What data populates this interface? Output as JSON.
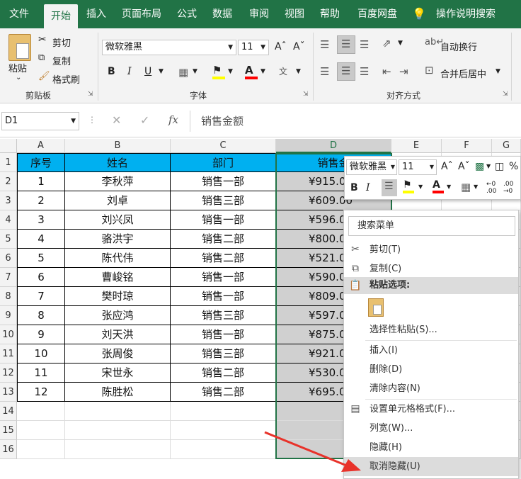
{
  "tabs": [
    "文件",
    "开始",
    "插入",
    "页面布局",
    "公式",
    "数据",
    "审阅",
    "视图",
    "帮助",
    "百度网盘",
    "操作说明搜索"
  ],
  "ribbon": {
    "paste": "粘贴",
    "cut": "剪切",
    "copy": "复制",
    "format_painter": "格式刷",
    "clipboard_group": "剪贴板",
    "font_name": "微软雅黑",
    "font_size": "11",
    "font_group": "字体",
    "bold": "B",
    "italic": "I",
    "underline": "U",
    "wrap_text": "自动换行",
    "merge_center": "合并后居中",
    "align_group": "对齐方式"
  },
  "formula_bar": {
    "name_box": "D1",
    "fx": "fx",
    "value": "销售金额"
  },
  "columns": [
    "A",
    "B",
    "C",
    "D",
    "E",
    "F",
    "G"
  ],
  "rows": [
    "1",
    "2",
    "3",
    "4",
    "5",
    "6",
    "7",
    "8",
    "9",
    "10",
    "11",
    "12",
    "13",
    "14",
    "15",
    "16"
  ],
  "table": {
    "headers": [
      "序号",
      "姓名",
      "部门",
      "销售金"
    ],
    "data": [
      [
        "1",
        "李秋萍",
        "销售一部",
        "¥915.0"
      ],
      [
        "2",
        "刘卓",
        "销售三部",
        "¥609.00"
      ],
      [
        "3",
        "刘兴凤",
        "销售一部",
        "¥596.0"
      ],
      [
        "4",
        "骆洪宇",
        "销售二部",
        "¥800.0"
      ],
      [
        "5",
        "陈代伟",
        "销售二部",
        "¥521.0"
      ],
      [
        "6",
        "曹峻铭",
        "销售一部",
        "¥590.0"
      ],
      [
        "7",
        "樊时琼",
        "销售一部",
        "¥809.0"
      ],
      [
        "8",
        "张应鸿",
        "销售三部",
        "¥597.0"
      ],
      [
        "9",
        "刘天洪",
        "销售一部",
        "¥875.0"
      ],
      [
        "10",
        "张周俊",
        "销售三部",
        "¥921.0"
      ],
      [
        "11",
        "宋世永",
        "销售二部",
        "¥530.0"
      ],
      [
        "12",
        "陈胜松",
        "销售二部",
        "¥695.0"
      ]
    ]
  },
  "mini_toolbar": {
    "font_name": "微软雅黑",
    "font_size": "11",
    "percent": "%",
    "bold": "B",
    "italic": "I"
  },
  "context_menu": {
    "search": "搜索菜单",
    "cut": "剪切(T)",
    "copy": "复制(C)",
    "paste_options": "粘贴选项:",
    "paste_special": "选择性粘贴(S)...",
    "insert": "插入(I)",
    "delete": "删除(D)",
    "clear": "清除内容(N)",
    "format_cells": "设置单元格格式(F)...",
    "col_width": "列宽(W)...",
    "hide": "隐藏(H)",
    "unhide": "取消隐藏(U)"
  },
  "colors": {
    "accent": "#217346",
    "header_fill": "#00b0f0",
    "annotation": "#e8322a"
  }
}
